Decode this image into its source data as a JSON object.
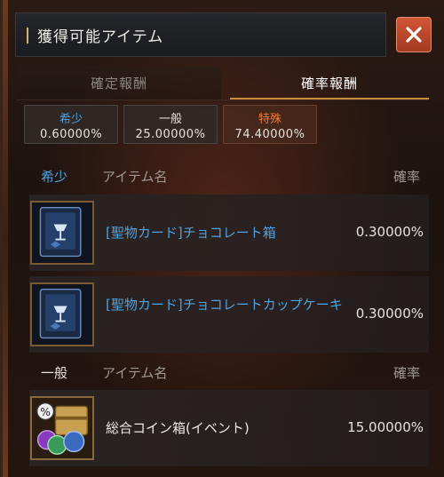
{
  "header": {
    "title": "獲得可能アイテム"
  },
  "tabs": [
    {
      "label": "確定報酬",
      "active": false
    },
    {
      "label": "確率報酬",
      "active": true
    }
  ],
  "rates": [
    {
      "name": "希少",
      "value": "0.60000%",
      "color": "#4ea2e0"
    },
    {
      "name": "一般",
      "value": "25.00000%",
      "color": "#e6e2dc"
    },
    {
      "name": "特殊",
      "value": "74.40000%",
      "color": "#f07a3a"
    }
  ],
  "sections": [
    {
      "category": "希少",
      "category_color": "#4ea2e0",
      "col_name": "アイテム名",
      "col_rate": "確率",
      "items": [
        {
          "name": "[聖物カード]チョコレート箱",
          "rate": "0.30000%",
          "icon": "holy-relic-card-icon"
        },
        {
          "name": "[聖物カード]チョコレートカップケーキ",
          "rate": "0.30000%",
          "icon": "holy-relic-card-icon"
        }
      ]
    },
    {
      "category": "一般",
      "category_color": "#e6e2dc",
      "col_name": "アイテム名",
      "col_rate": "確率",
      "items": [
        {
          "name": "総合コイン箱(イベント)",
          "rate": "15.00000%",
          "icon": "coin-chest-icon"
        }
      ]
    }
  ]
}
